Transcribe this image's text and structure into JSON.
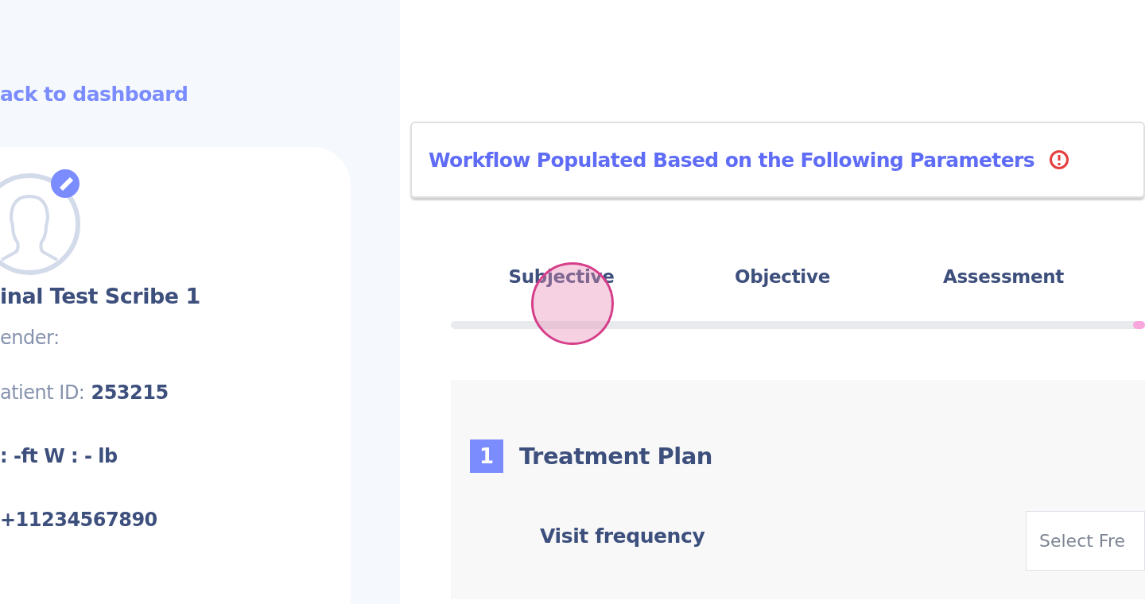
{
  "back_link": "ack to dashboard",
  "patient": {
    "name": "inal Test Scribe 1",
    "fields": [
      {
        "label": "ender:"
      },
      {
        "label": "atient ID:",
        "value": "253215"
      },
      {
        "value": ": -ft W : - lb"
      },
      {
        "value": "+11234567890"
      }
    ]
  },
  "workflow_banner": {
    "title": "Workflow Populated Based on the Following Parameters"
  },
  "tabs": [
    {
      "label": "Subjective",
      "selected": false
    },
    {
      "label": "Objective",
      "selected": false
    },
    {
      "label": "Assessment",
      "selected": false
    }
  ],
  "section": {
    "number": "1",
    "title": "Treatment Plan",
    "fields": [
      {
        "label": "Visit frequency",
        "placeholder": "Select Fre"
      }
    ]
  }
}
